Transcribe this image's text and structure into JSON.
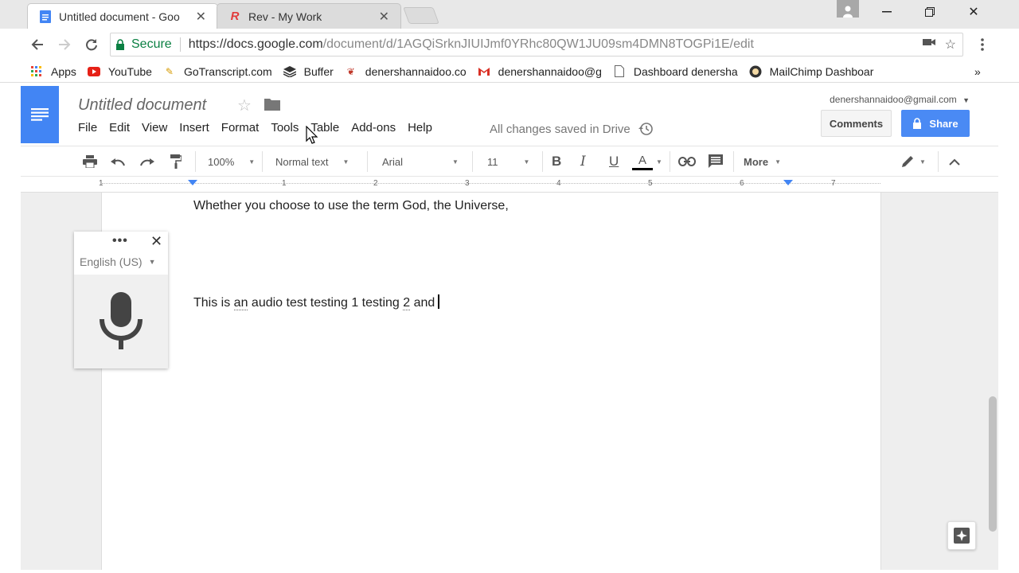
{
  "browser": {
    "tabs": [
      {
        "label": "Untitled document - Goo",
        "active": true
      },
      {
        "label": "Rev - My Work",
        "active": false
      }
    ],
    "address": {
      "secure_label": "Secure",
      "url_host": "https://docs.google.com",
      "url_path": "/document/d/1AGQiSrknJIUIJmf0YRhc80QW1JU09sm4DMN8TOGPi1E/edit"
    },
    "bookmarks": [
      {
        "label": "Apps",
        "icon": "apps-grid-icon"
      },
      {
        "label": "YouTube",
        "icon": "youtube-icon"
      },
      {
        "label": "GoTranscript.com",
        "icon": "gotranscript-icon"
      },
      {
        "label": "Buffer",
        "icon": "buffer-icon"
      },
      {
        "label": "denershannaidoo.co",
        "icon": "site-icon"
      },
      {
        "label": "denershannaidoo@g",
        "icon": "gmail-icon"
      },
      {
        "label": "Dashboard denersha",
        "icon": "page-icon"
      },
      {
        "label": "MailChimp Dashboar",
        "icon": "mailchimp-icon"
      }
    ]
  },
  "docs": {
    "title": "Untitled document",
    "menu": [
      "File",
      "Edit",
      "View",
      "Insert",
      "Format",
      "Tools",
      "Table",
      "Add-ons",
      "Help"
    ],
    "save_status": "All changes saved in Drive",
    "account": "denershannaidoo@gmail.com",
    "comments_label": "Comments",
    "share_label": "Share",
    "toolbar": {
      "zoom": "100%",
      "style": "Normal text",
      "font": "Arial",
      "size": "11",
      "bold": "B",
      "italic": "I",
      "underline": "U",
      "text_color": "A",
      "more": "More"
    },
    "ruler_numbers": [
      "1",
      "1",
      "2",
      "3",
      "4",
      "5",
      "6",
      "7"
    ],
    "body": {
      "line1": "Whether you choose to use the term God, the Universe,",
      "line2_a": "This is ",
      "line2_b": "an",
      "line2_c": " audio test testing 1 testing ",
      "line2_d": "2",
      "line2_e": " and"
    },
    "voice_typing": {
      "dots": "•••",
      "language": "English (US)"
    }
  },
  "colors": {
    "docs_blue": "#4285f4",
    "share_blue": "#4a8af4",
    "secure_green": "#0b8043"
  }
}
